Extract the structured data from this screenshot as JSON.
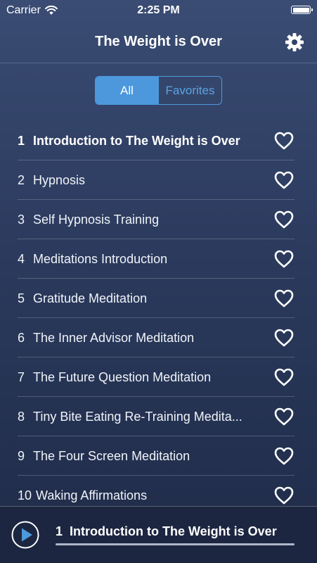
{
  "status_bar": {
    "carrier": "Carrier",
    "time": "2:25 PM",
    "battery_level": 1.0
  },
  "header": {
    "title": "The Weight is Over",
    "settings_icon": "gear-icon"
  },
  "filter": {
    "options": [
      "All",
      "Favorites"
    ],
    "selected": "All"
  },
  "tracks": [
    {
      "number": "1",
      "title": "Introduction to The Weight is Over",
      "favorite": false,
      "selected": true
    },
    {
      "number": "2",
      "title": "Hypnosis",
      "favorite": false,
      "selected": false
    },
    {
      "number": "3",
      "title": "Self Hypnosis Training",
      "favorite": false,
      "selected": false
    },
    {
      "number": "4",
      "title": "Meditations Introduction",
      "favorite": false,
      "selected": false
    },
    {
      "number": "5",
      "title": "Gratitude Meditation",
      "favorite": false,
      "selected": false
    },
    {
      "number": "6",
      "title": "The Inner Advisor Meditation",
      "favorite": false,
      "selected": false
    },
    {
      "number": "7",
      "title": "The Future Question Meditation",
      "favorite": false,
      "selected": false
    },
    {
      "number": "8",
      "title": "Tiny Bite Eating Re-Training Medita...",
      "favorite": false,
      "selected": false
    },
    {
      "number": "9",
      "title": "The Four Screen Meditation",
      "favorite": false,
      "selected": false
    },
    {
      "number": "10",
      "title": "Waking Affirmations",
      "favorite": false,
      "selected": false
    }
  ],
  "player": {
    "track_number": "1",
    "track_title": "Introduction to The Weight is Over",
    "progress": 0,
    "play_icon": "play-icon"
  },
  "colors": {
    "accent": "#4d98dc",
    "background_top": "#3a4c73",
    "background_bottom": "#1f2b48",
    "player_background": "#1c2641"
  }
}
